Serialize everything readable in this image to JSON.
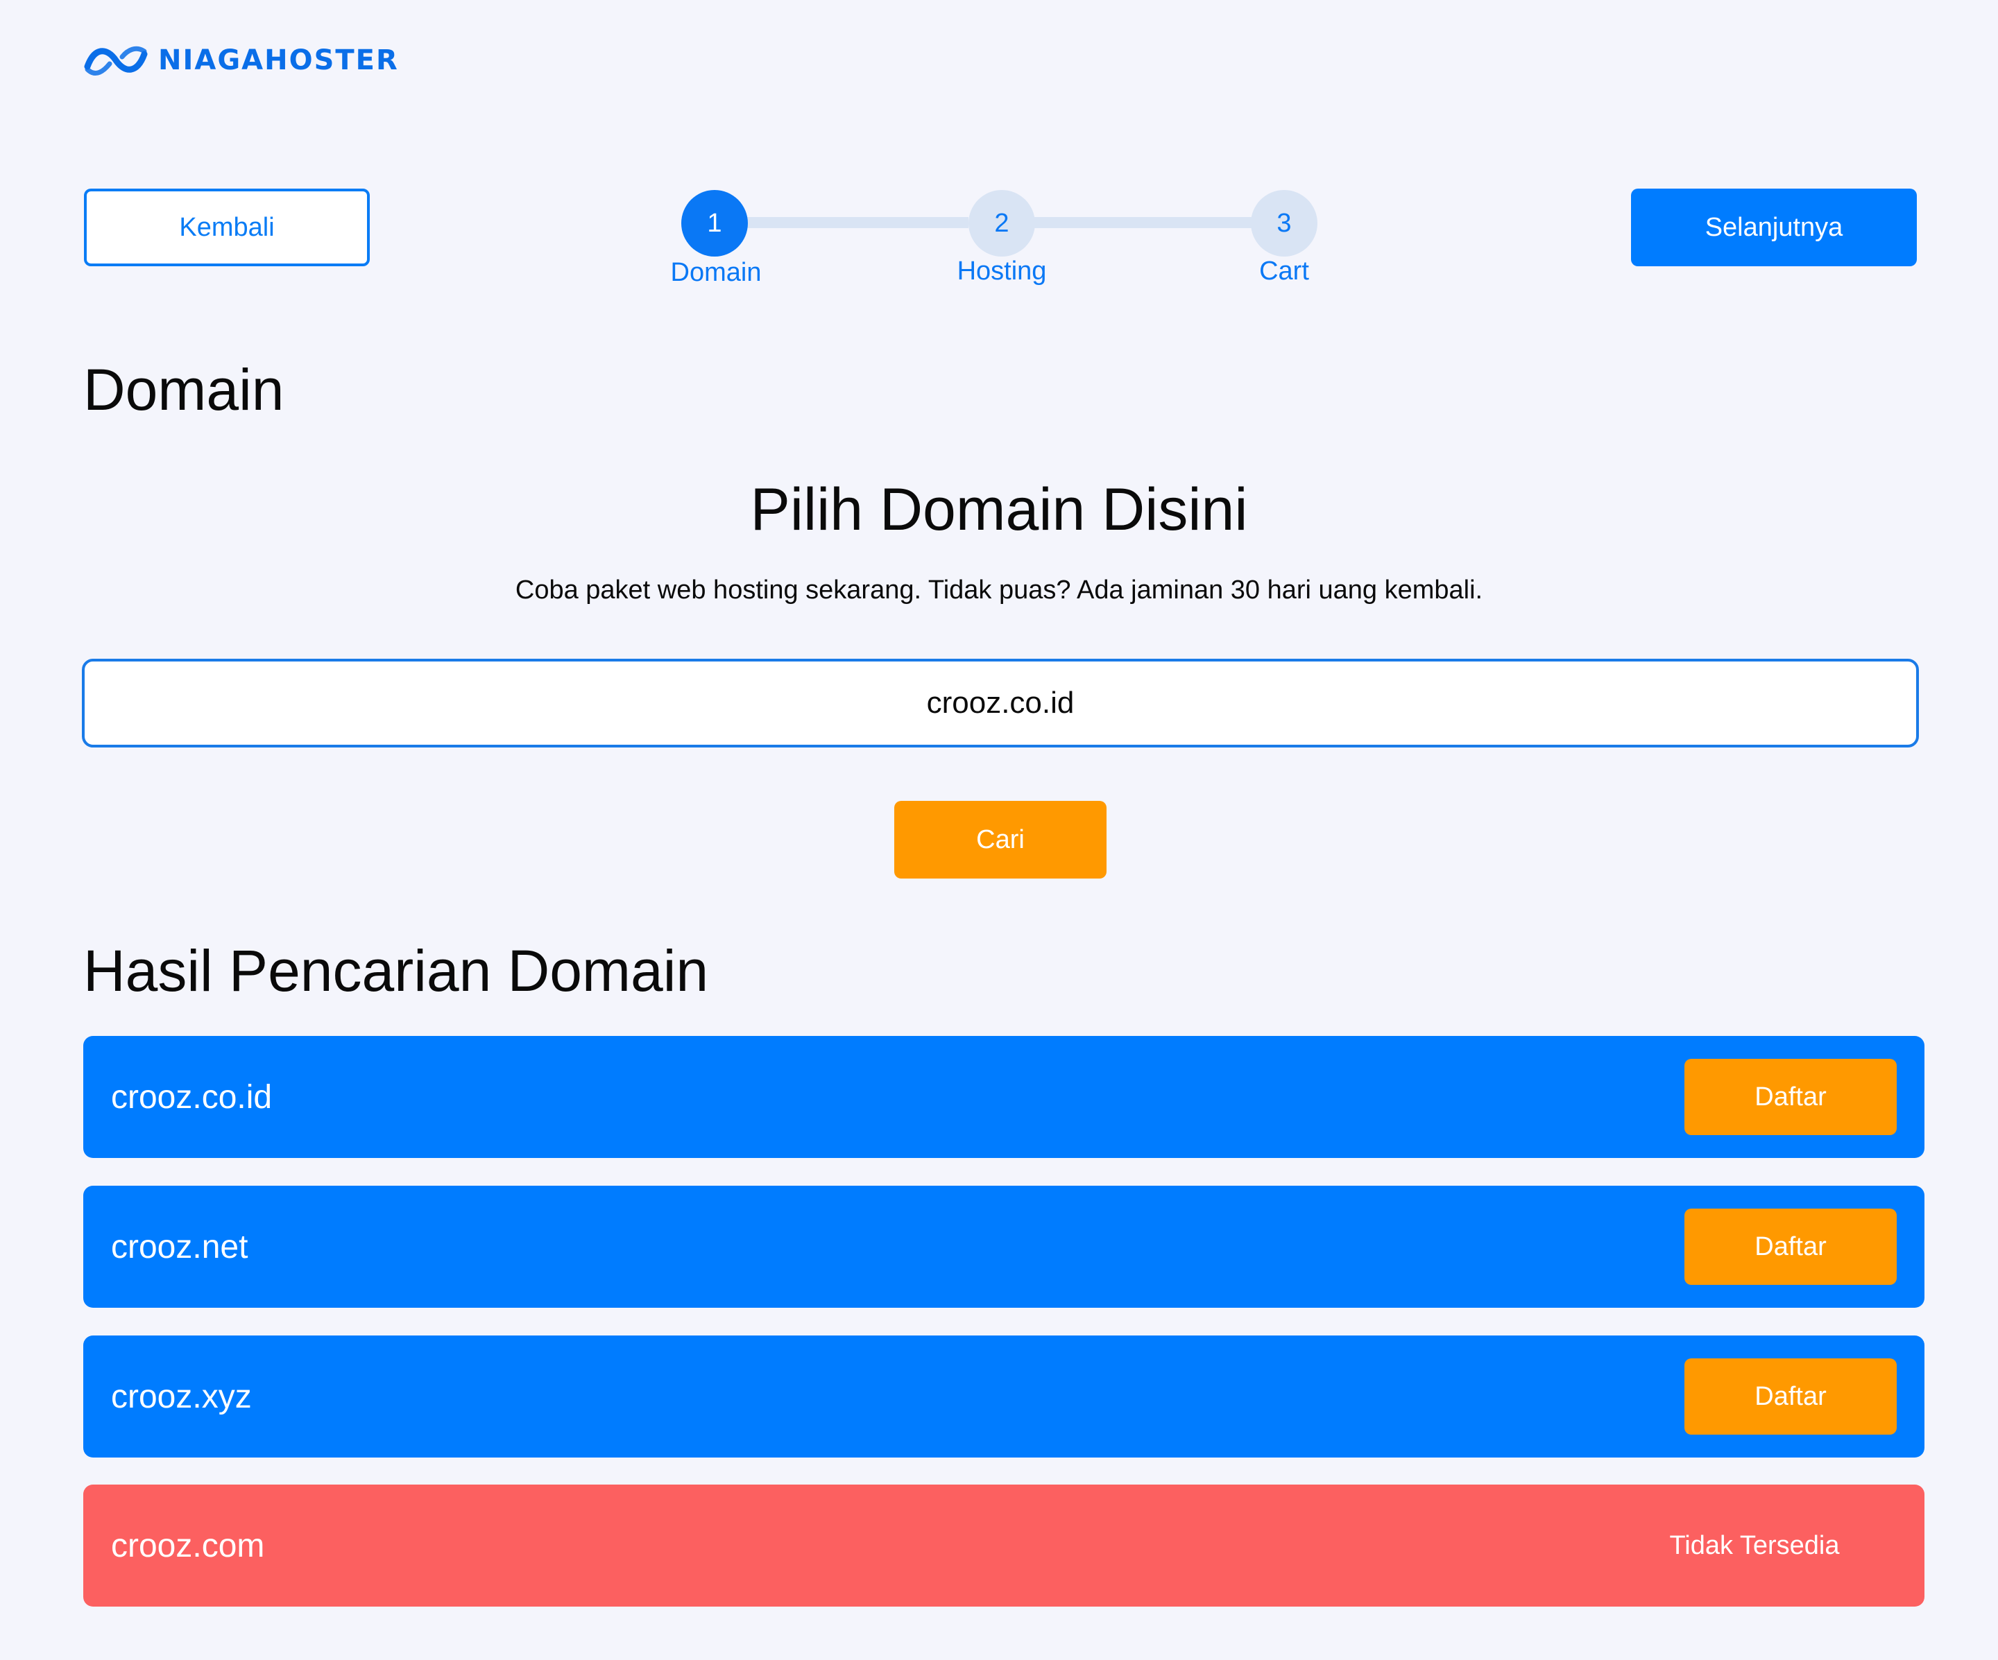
{
  "brand": {
    "name": "NIAGAHOSTER",
    "logo_icon": "wave-infinity-icon",
    "color": "#0A6EE8"
  },
  "nav": {
    "back_label": "Kembali",
    "next_label": "Selanjutnya"
  },
  "stepper": {
    "current_step": 1,
    "steps": [
      {
        "number": "1",
        "label": "Domain"
      },
      {
        "number": "2",
        "label": "Hosting"
      },
      {
        "number": "3",
        "label": "Cart"
      }
    ]
  },
  "page": {
    "title": "Domain",
    "hero_title": "Pilih Domain Disini",
    "hero_subtitle": "Coba paket web hosting sekarang. Tidak puas? Ada jaminan 30 hari uang kembali."
  },
  "search": {
    "value": "crooz.co.id",
    "button_label": "Cari"
  },
  "results": {
    "title": "Hasil Pencarian Domain",
    "items": [
      {
        "domain": "crooz.co.id",
        "available": true,
        "action_label": "Daftar"
      },
      {
        "domain": "crooz.net",
        "available": true,
        "action_label": "Daftar"
      },
      {
        "domain": "crooz.xyz",
        "available": true,
        "action_label": "Daftar"
      },
      {
        "domain": "crooz.com",
        "available": false,
        "status_label": "Tidak Tersedia"
      }
    ]
  },
  "colors": {
    "background": "#F4F5FC",
    "primary": "#007CFF",
    "accent": "#FF9900",
    "unavailable": "#FC6060",
    "step_inactive": "#D9E4F4"
  }
}
